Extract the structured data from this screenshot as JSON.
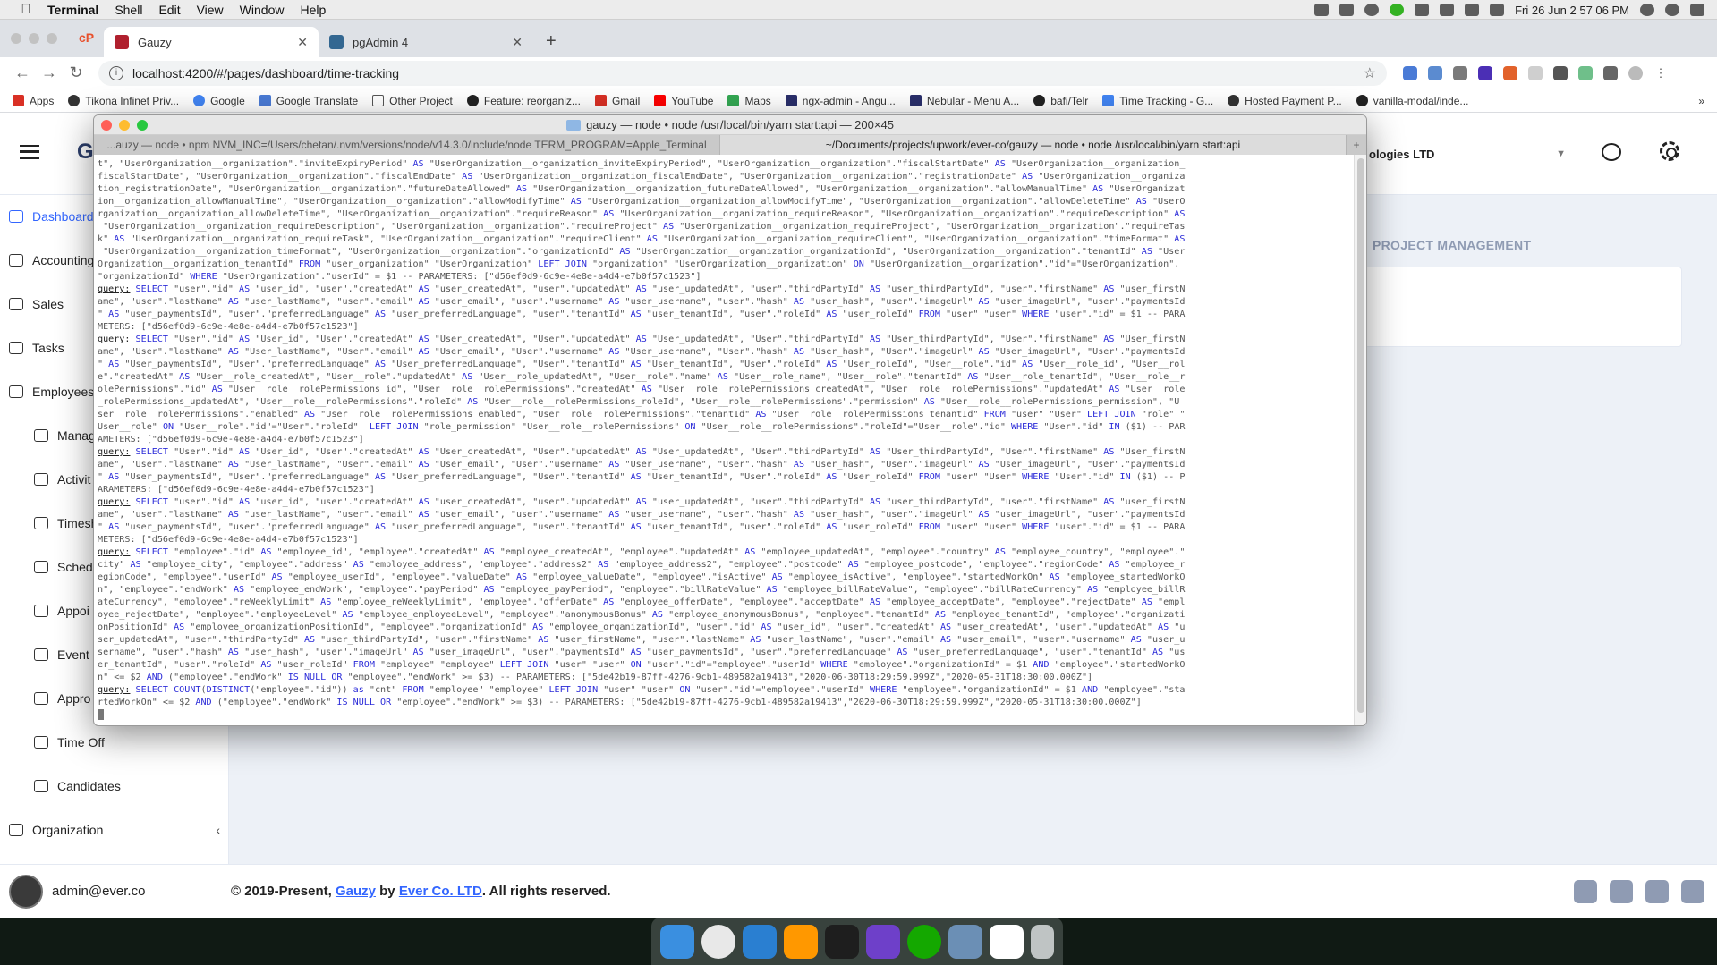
{
  "menubar": {
    "app_name": "Terminal",
    "items": [
      "Shell",
      "Edit",
      "View",
      "Window",
      "Help"
    ],
    "clock": "Fri 26 Jun  2 57 06 PM"
  },
  "browser": {
    "tabs": [
      {
        "title": "Gauzy",
        "active": true
      },
      {
        "title": "pgAdmin 4",
        "active": false
      }
    ],
    "url": "localhost:4200/#/pages/dashboard/time-tracking",
    "bookmarks": [
      "Apps",
      "Tikona Infinet Priv...",
      "Google",
      "Google Translate",
      "Other Project",
      "Feature: reorganiz...",
      "Gmail",
      "YouTube",
      "Maps",
      "ngx-admin - Angu...",
      "Nebular - Menu A...",
      "bafi/Telr",
      "Time Tracking - G...",
      "Hosted Payment P...",
      "vanilla-modal/inde..."
    ]
  },
  "app": {
    "logo": "G",
    "org_name": "ologies LTD",
    "section_title": "PROJECT MANAGEMENT",
    "sidebar": [
      {
        "label": "Dashboard",
        "active": true,
        "sub": false
      },
      {
        "label": "Accounting",
        "sub": false
      },
      {
        "label": "Sales",
        "sub": false
      },
      {
        "label": "Tasks",
        "sub": false
      },
      {
        "label": "Employees",
        "sub": false
      },
      {
        "label": "Manag",
        "sub": true
      },
      {
        "label": "Activit",
        "sub": true
      },
      {
        "label": "Timesh",
        "sub": true
      },
      {
        "label": "Sched",
        "sub": true
      },
      {
        "label": "Appoi",
        "sub": true
      },
      {
        "label": "Event",
        "sub": true
      },
      {
        "label": "Appro",
        "sub": true
      },
      {
        "label": "Time Off",
        "sub": true
      },
      {
        "label": "Candidates",
        "sub": true
      },
      {
        "label": "Organization",
        "sub": false
      }
    ],
    "footer": {
      "user": "admin@ever.co",
      "prefix": "© 2019-Present, ",
      "brand": "Gauzy",
      "by": " by ",
      "company": "Ever Co. LTD",
      "suffix": ". All rights reserved."
    }
  },
  "terminal": {
    "title": "gauzy — node • node /usr/local/bin/yarn start:api — 200×45",
    "tabs": [
      "...auzy — node • npm NVM_INC=/Users/chetan/.nvm/versions/node/v14.3.0/include/node TERM_PROGRAM=Apple_Terminal",
      "~/Documents/projects/upwork/ever-co/gauzy — node • node /usr/local/bin/yarn start:api"
    ],
    "lines": [
      "t\", \"UserOrganization__organization\".\"inviteExpiryPeriod\" AS \"UserOrganization__organization_inviteExpiryPeriod\", \"UserOrganization__organization\".\"fiscalStartDate\" AS \"UserOrganization__organization_",
      "fiscalStartDate\", \"UserOrganization__organization\".\"fiscalEndDate\" AS \"UserOrganization__organization_fiscalEndDate\", \"UserOrganization__organization\".\"registrationDate\" AS \"UserOrganization__organiza",
      "tion_registrationDate\", \"UserOrganization__organization\".\"futureDateAllowed\" AS \"UserOrganization__organization_futureDateAllowed\", \"UserOrganization__organization\".\"allowManualTime\" AS \"UserOrganizat",
      "ion__organization_allowManualTime\", \"UserOrganization__organization\".\"allowModifyTime\" AS \"UserOrganization__organization_allowModifyTime\", \"UserOrganization__organization\".\"allowDeleteTime\" AS \"UserO",
      "rganization__organization_allowDeleteTime\", \"UserOrganization__organization\".\"requireReason\" AS \"UserOrganization__organization_requireReason\", \"UserOrganization__organization\".\"requireDescription\" AS",
      " \"UserOrganization__organization_requireDescription\", \"UserOrganization__organization\".\"requireProject\" AS \"UserOrganization__organization_requireProject\", \"UserOrganization__organization\".\"requireTas",
      "k\" AS \"UserOrganization__organization_requireTask\", \"UserOrganization__organization\".\"requireClient\" AS \"UserOrganization__organization_requireClient\", \"UserOrganization__organization\".\"timeFormat\" AS",
      " \"UserOrganization__organization_timeFormat\", \"UserOrganization__organization\".\"organizationId\" AS \"UserOrganization__organization_organizationId\", \"UserOrganization__organization\".\"tenantId\" AS \"User",
      "Organization__organization_tenantId\" FROM \"user_organization\" \"UserOrganization\" LEFT JOIN \"organization\" \"UserOrganization__organization\" ON \"UserOrganization__organization\".\"id\"=\"UserOrganization\".",
      "\"organizationId\" WHERE \"UserOrganization\".\"userId\" = $1 -- PARAMETERS: [\"d56ef0d9-6c9e-4e8e-a4d4-e7b0f57c1523\"]",
      "query: SELECT \"user\".\"id\" AS \"user_id\", \"user\".\"createdAt\" AS \"user_createdAt\", \"user\".\"updatedAt\" AS \"user_updatedAt\", \"user\".\"thirdPartyId\" AS \"user_thirdPartyId\", \"user\".\"firstName\" AS \"user_firstN",
      "ame\", \"user\".\"lastName\" AS \"user_lastName\", \"user\".\"email\" AS \"user_email\", \"user\".\"username\" AS \"user_username\", \"user\".\"hash\" AS \"user_hash\", \"user\".\"imageUrl\" AS \"user_imageUrl\", \"user\".\"paymentsId",
      "\" AS \"user_paymentsId\", \"user\".\"preferredLanguage\" AS \"user_preferredLanguage\", \"user\".\"tenantId\" AS \"user_tenantId\", \"user\".\"roleId\" AS \"user_roleId\" FROM \"user\" \"user\" WHERE \"user\".\"id\" = $1 -- PARA",
      "METERS: [\"d56ef0d9-6c9e-4e8e-a4d4-e7b0f57c1523\"]",
      "query: SELECT \"User\".\"id\" AS \"User_id\", \"User\".\"createdAt\" AS \"User_createdAt\", \"User\".\"updatedAt\" AS \"User_updatedAt\", \"User\".\"thirdPartyId\" AS \"User_thirdPartyId\", \"User\".\"firstName\" AS \"User_firstN",
      "ame\", \"User\".\"lastName\" AS \"User_lastName\", \"User\".\"email\" AS \"User_email\", \"User\".\"username\" AS \"User_username\", \"User\".\"hash\" AS \"User_hash\", \"User\".\"imageUrl\" AS \"User_imageUrl\", \"User\".\"paymentsId",
      "\" AS \"User_paymentsId\", \"User\".\"preferredLanguage\" AS \"User_preferredLanguage\", \"User\".\"tenantId\" AS \"User_tenantId\", \"User\".\"roleId\" AS \"User_roleId\", \"User__role\".\"id\" AS \"User__role_id\", \"User__rol",
      "e\".\"createdAt\" AS \"User__role_createdAt\", \"User__role\".\"updatedAt\" AS \"User__role_updatedAt\", \"User__role\".\"name\" AS \"User__role_name\", \"User__role\".\"tenantId\" AS \"User__role_tenantId\", \"User__role__r",
      "olePermissions\".\"id\" AS \"User__role__rolePermissions_id\", \"User__role__rolePermissions\".\"createdAt\" AS \"User__role__rolePermissions_createdAt\", \"User__role__rolePermissions\".\"updatedAt\" AS \"User__role",
      "_rolePermissions_updatedAt\", \"User__role__rolePermissions\".\"roleId\" AS \"User__role__rolePermissions_roleId\", \"User__role__rolePermissions\".\"permission\" AS \"User__role__rolePermissions_permission\", \"U",
      "ser__role__rolePermissions\".\"enabled\" AS \"User__role__rolePermissions_enabled\", \"User__role__rolePermissions\".\"tenantId\" AS \"User__role__rolePermissions_tenantId\" FROM \"user\" \"User\" LEFT JOIN \"role\" \"",
      "User__role\" ON \"User__role\".\"id\"=\"User\".\"roleId\"  LEFT JOIN \"role_permission\" \"User__role__rolePermissions\" ON \"User__role__rolePermissions\".\"roleId\"=\"User__role\".\"id\" WHERE \"User\".\"id\" IN ($1) -- PAR",
      "AMETERS: [\"d56ef0d9-6c9e-4e8e-a4d4-e7b0f57c1523\"]",
      "query: SELECT \"User\".\"id\" AS \"User_id\", \"User\".\"createdAt\" AS \"User_createdAt\", \"User\".\"updatedAt\" AS \"User_updatedAt\", \"User\".\"thirdPartyId\" AS \"User_thirdPartyId\", \"User\".\"firstName\" AS \"User_firstN",
      "ame\", \"User\".\"lastName\" AS \"User_lastName\", \"User\".\"email\" AS \"User_email\", \"User\".\"username\" AS \"User_username\", \"User\".\"hash\" AS \"User_hash\", \"User\".\"imageUrl\" AS \"User_imageUrl\", \"User\".\"paymentsId",
      "\" AS \"User_paymentsId\", \"User\".\"preferredLanguage\" AS \"User_preferredLanguage\", \"User\".\"tenantId\" AS \"User_tenantId\", \"User\".\"roleId\" AS \"User_roleId\" FROM \"user\" \"User\" WHERE \"User\".\"id\" IN ($1) -- P",
      "ARAMETERS: [\"d56ef0d9-6c9e-4e8e-a4d4-e7b0f57c1523\"]",
      "query: SELECT \"user\".\"id\" AS \"user_id\", \"user\".\"createdAt\" AS \"user_createdAt\", \"user\".\"updatedAt\" AS \"user_updatedAt\", \"user\".\"thirdPartyId\" AS \"user_thirdPartyId\", \"user\".\"firstName\" AS \"user_firstN",
      "ame\", \"user\".\"lastName\" AS \"user_lastName\", \"user\".\"email\" AS \"user_email\", \"user\".\"username\" AS \"user_username\", \"user\".\"hash\" AS \"user_hash\", \"user\".\"imageUrl\" AS \"user_imageUrl\", \"user\".\"paymentsId",
      "\" AS \"user_paymentsId\", \"user\".\"preferredLanguage\" AS \"user_preferredLanguage\", \"user\".\"tenantId\" AS \"user_tenantId\", \"user\".\"roleId\" AS \"user_roleId\" FROM \"user\" \"user\" WHERE \"user\".\"id\" = $1 -- PARA",
      "METERS: [\"d56ef0d9-6c9e-4e8e-a4d4-e7b0f57c1523\"]",
      "query: SELECT \"employee\".\"id\" AS \"employee_id\", \"employee\".\"createdAt\" AS \"employee_createdAt\", \"employee\".\"updatedAt\" AS \"employee_updatedAt\", \"employee\".\"country\" AS \"employee_country\", \"employee\".\"",
      "city\" AS \"employee_city\", \"employee\".\"address\" AS \"employee_address\", \"employee\".\"address2\" AS \"employee_address2\", \"employee\".\"postcode\" AS \"employee_postcode\", \"employee\".\"regionCode\" AS \"employee_r",
      "egionCode\", \"employee\".\"userId\" AS \"employee_userId\", \"employee\".\"valueDate\" AS \"employee_valueDate\", \"employee\".\"isActive\" AS \"employee_isActive\", \"employee\".\"startedWorkOn\" AS \"employee_startedWorkO",
      "n\", \"employee\".\"endWork\" AS \"employee_endWork\", \"employee\".\"payPeriod\" AS \"employee_payPeriod\", \"employee\".\"billRateValue\" AS \"employee_billRateValue\", \"employee\".\"billRateCurrency\" AS \"employee_billR",
      "ateCurrency\", \"employee\".\"reWeeklyLimit\" AS \"employee_reWeeklyLimit\", \"employee\".\"offerDate\" AS \"employee_offerDate\", \"employee\".\"acceptDate\" AS \"employee_acceptDate\", \"employee\".\"rejectDate\" AS \"empl",
      "oyee_rejectDate\", \"employee\".\"employeeLevel\" AS \"employee_employeeLevel\", \"employee\".\"anonymousBonus\" AS \"employee_anonymousBonus\", \"employee\".\"tenantId\" AS \"employee_tenantId\", \"employee\".\"organizati",
      "onPositionId\" AS \"employee_organizationPositionId\", \"employee\".\"organizationId\" AS \"employee_organizationId\", \"user\".\"id\" AS \"user_id\", \"user\".\"createdAt\" AS \"user_createdAt\", \"user\".\"updatedAt\" AS \"u",
      "ser_updatedAt\", \"user\".\"thirdPartyId\" AS \"user_thirdPartyId\", \"user\".\"firstName\" AS \"user_firstName\", \"user\".\"lastName\" AS \"user_lastName\", \"user\".\"email\" AS \"user_email\", \"user\".\"username\" AS \"user_u",
      "sername\", \"user\".\"hash\" AS \"user_hash\", \"user\".\"imageUrl\" AS \"user_imageUrl\", \"user\".\"paymentsId\" AS \"user_paymentsId\", \"user\".\"preferredLanguage\" AS \"user_preferredLanguage\", \"user\".\"tenantId\" AS \"us",
      "er_tenantId\", \"user\".\"roleId\" AS \"user_roleId\" FROM \"employee\" \"employee\" LEFT JOIN \"user\" \"user\" ON \"user\".\"id\"=\"employee\".\"userId\" WHERE \"employee\".\"organizationId\" = $1 AND \"employee\".\"startedWorkO",
      "n\" <= $2 AND (\"employee\".\"endWork\" IS NULL OR \"employee\".\"endWork\" >= $3) -- PARAMETERS: [\"5de42b19-87ff-4276-9cb1-489582a19413\",\"2020-06-30T18:29:59.999Z\",\"2020-05-31T18:30:00.000Z\"]",
      "query: SELECT COUNT(DISTINCT(\"employee\".\"id\")) as \"cnt\" FROM \"employee\" \"employee\" LEFT JOIN \"user\" \"user\" ON \"user\".\"id\"=\"employee\".\"userId\" WHERE \"employee\".\"organizationId\" = $1 AND \"employee\".\"sta",
      "rtedWorkOn\" <= $2 AND (\"employee\".\"endWork\" IS NULL OR \"employee\".\"endWork\" >= $3) -- PARAMETERS: [\"5de42b19-87ff-4276-9cb1-489582a19413\",\"2020-06-30T18:29:59.999Z\",\"2020-05-31T18:30:00.000Z\"]"
    ]
  },
  "colors": {
    "accent": "#3366ff",
    "keyword": "#2b2bd8",
    "terminal_text": "#555555"
  }
}
